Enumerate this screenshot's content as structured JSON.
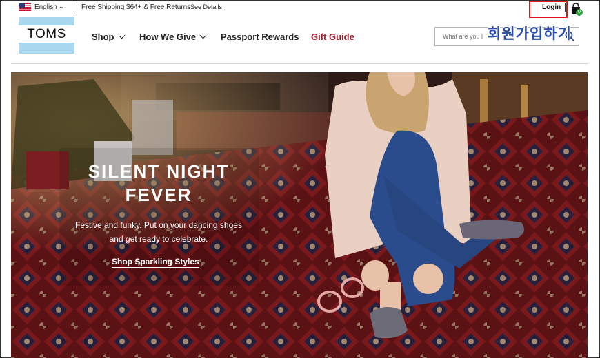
{
  "topbar": {
    "language": "English",
    "shipping": "Free Shipping $64+ & Free Returns",
    "see_details": "See Details",
    "login": "Login",
    "cart_count": "0"
  },
  "header": {
    "logo": "TOMS",
    "nav": [
      "Shop",
      "How We Give",
      "Passport Rewards",
      "Gift Guide"
    ],
    "search_placeholder": "What are you l",
    "overlay_text": "회원가입하기"
  },
  "hero": {
    "title_line1": "SILENT NIGHT",
    "title_line2": "FEVER",
    "subtitle_line1": "Festive and funky. Put on your dancing shoes",
    "subtitle_line2": "and get ready to celebrate.",
    "cta": "Shop Sparkling Styles"
  },
  "colors": {
    "accent_red": "#a31d2f",
    "logo_blue": "#a8d7f0",
    "annotation_red": "#e31414",
    "overlay_blue": "#2b4fae",
    "cart_badge": "#2fa33f"
  }
}
